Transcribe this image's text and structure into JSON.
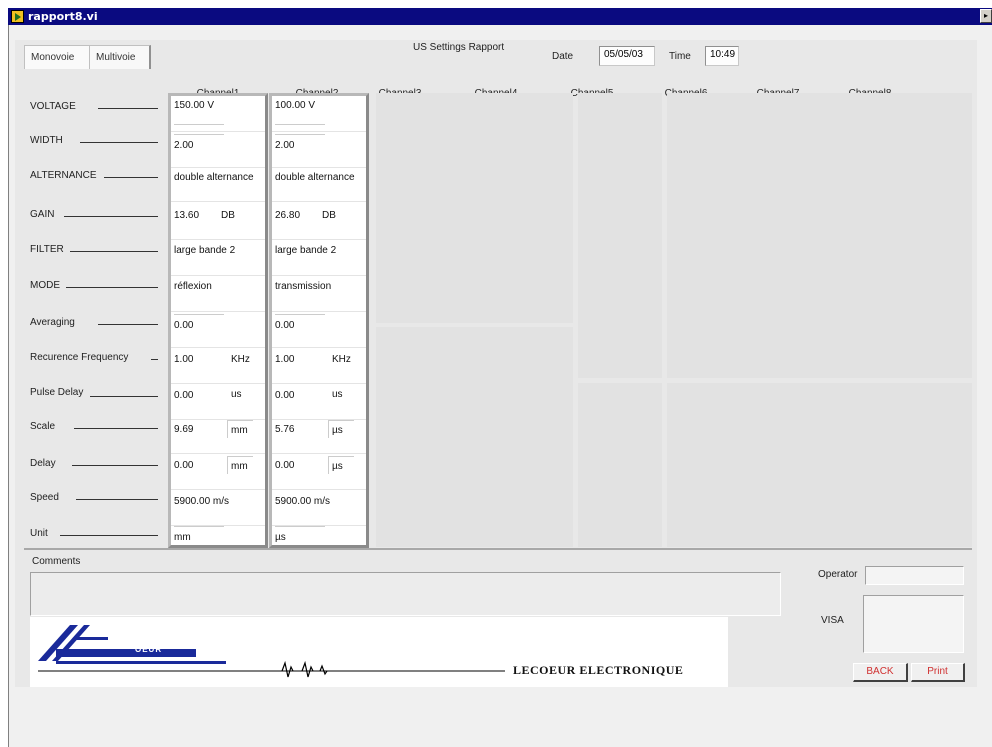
{
  "window": {
    "title": "rapport8.vi"
  },
  "tabs": [
    {
      "label": "Monovoie"
    },
    {
      "label": "Multivoie"
    }
  ],
  "header": {
    "title": "US Settings Rapport",
    "date_label": "Date",
    "date_value": "05/05/03",
    "time_label": "Time",
    "time_value": "10:49"
  },
  "channels": [
    "Channel1",
    "Channel2",
    "Channel3",
    "Channel4",
    "Channel5",
    "Channel6",
    "Channel7",
    "Channel8"
  ],
  "rows": [
    "VOLTAGE",
    "WIDTH",
    "ALTERNANCE",
    "GAIN",
    "FILTER",
    "MODE",
    "Averaging",
    "Recurence Frequency",
    "Pulse Delay",
    "Scale",
    "Delay",
    "Speed",
    "Unit"
  ],
  "channel1": {
    "voltage": "150.00  V",
    "width": "2.00",
    "alternance": "double alternance",
    "gain": "13.60",
    "gain_unit": "DB",
    "filter": "large bande 2",
    "mode": "réflexion",
    "averaging": "0.00",
    "freq": "1.00",
    "freq_unit": "KHz",
    "pulse_delay": "0.00",
    "pulse_delay_unit": "us",
    "scale": "9.69",
    "scale_unit": "mm",
    "delay": "0.00",
    "delay_unit": "mm",
    "speed": "5900.00  m/s",
    "unit": "mm"
  },
  "channel2": {
    "voltage": "100.00  V",
    "width": "2.00",
    "alternance": "double alternance",
    "gain": "26.80",
    "gain_unit": "DB",
    "filter": "large bande 2",
    "mode": "transmission",
    "averaging": "0.00",
    "freq": "1.00",
    "freq_unit": "KHz",
    "pulse_delay": "0.00",
    "pulse_delay_unit": "us",
    "scale": "5.76",
    "scale_unit": "µs",
    "delay": "0.00",
    "delay_unit": "µs",
    "speed": "5900.00  m/s",
    "unit": "µs"
  },
  "comments_label": "Comments",
  "operator_label": "Operator",
  "visa_label": "VISA",
  "logo": {
    "text": "OEUR",
    "company": "LECOEUR ELECTRONIQUE"
  },
  "buttons": {
    "back": "BACK",
    "print": "Print"
  },
  "colors": {
    "titlebar": "#0a0a80",
    "button_text": "#d03030",
    "logo_blue": "#1a2a9a"
  }
}
